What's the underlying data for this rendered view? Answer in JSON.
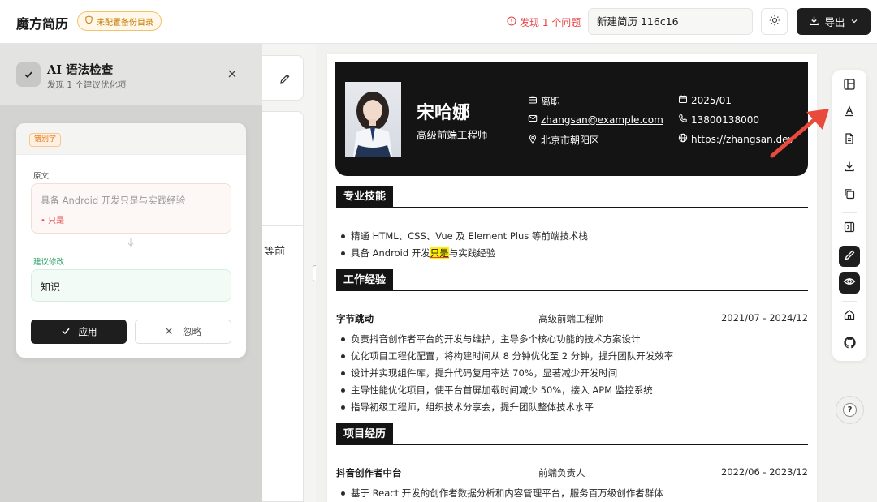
{
  "app": {
    "title": "魔方简历",
    "backup_badge": "未配置备份目录",
    "issue_text": "发现 1 个问题",
    "filename": "新建简历 116c16",
    "export_label": "导出"
  },
  "checker": {
    "title": "AI 语法检查",
    "subtitle": "发现 1 个建议优化项",
    "tag": "错别字",
    "original_label": "原文",
    "original_text": "具备 Android 开发只是与实践经验",
    "original_word": "只是",
    "suggest_label": "建议修改",
    "suggest_text": "知识",
    "apply_label": "应用",
    "ignore_label": "忽略"
  },
  "editor": {
    "partial_text": "等前"
  },
  "resume": {
    "name": "宋哈娜",
    "job_title": "高级前端工程师",
    "status": "离职",
    "email": "zhangsan@example.com",
    "location": "北京市朝阳区",
    "date": "2025/01",
    "phone": "13800138000",
    "website": "https://zhangsan.dev",
    "skills_title": "专业技能",
    "skills": [
      "精通 HTML、CSS、Vue 及 Element Plus 等前端技术栈"
    ],
    "skill_2_before": "具备 Android 开发",
    "skill_2_highlight": "只是",
    "skill_2_after": "与实践经验",
    "work_title": "工作经验",
    "work": {
      "company": "字节跳动",
      "role": "高级前端工程师",
      "period": "2021/07 - 2024/12",
      "bullets": [
        "负责抖音创作者平台的开发与维护，主导多个核心功能的技术方案设计",
        "优化项目工程化配置，将构建时间从 8 分钟优化至 2 分钟，提升团队开发效率",
        "设计并实现组件库，提升代码复用率达 70%，显著减少开发时间",
        "主导性能优化项目，使平台首屏加载时间减少 50%，接入 APM 监控系统",
        "指导初级工程师，组织技术分享会，提升团队整体技术水平"
      ]
    },
    "project_title": "项目经历",
    "project": {
      "name": "抖音创作者中台",
      "role": "前端负责人",
      "period": "2022/06 - 2023/12",
      "bullets": [
        "基于 React 开发的创作者数据分析和内容管理平台，服务百万级创作者群体"
      ]
    }
  },
  "colors": {
    "accent_dark": "#141414",
    "issue_red": "#e64545",
    "badge_orange": "#c77a06",
    "suggest_green": "#2ea46a",
    "highlight": "#fff000"
  },
  "icons": {
    "toolbar": [
      "layout-icon",
      "font-icon",
      "document-icon",
      "download-icon",
      "copy-icon",
      "panel-toggle-icon",
      "pen-icon",
      "eye-icon",
      "home-icon",
      "github-icon"
    ]
  }
}
